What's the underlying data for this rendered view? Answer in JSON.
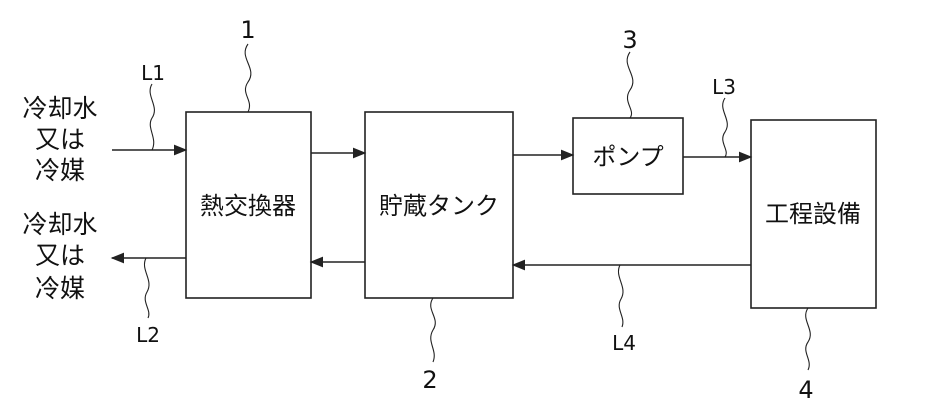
{
  "blocks": {
    "heat_exchanger": {
      "label": "熱交換器",
      "number": "1"
    },
    "storage_tank": {
      "label": "貯蔵タンク",
      "number": "2"
    },
    "pump": {
      "label": "ポンプ",
      "number": "3"
    },
    "process_equipment": {
      "label": "工程設備",
      "number": "4"
    }
  },
  "lines": {
    "L1": "L1",
    "L2": "L2",
    "L3": "L3",
    "L4": "L4"
  },
  "inlet_text": [
    "冷却水",
    "又は",
    "冷媒"
  ],
  "outlet_text": [
    "冷却水",
    "又は",
    "冷媒"
  ]
}
